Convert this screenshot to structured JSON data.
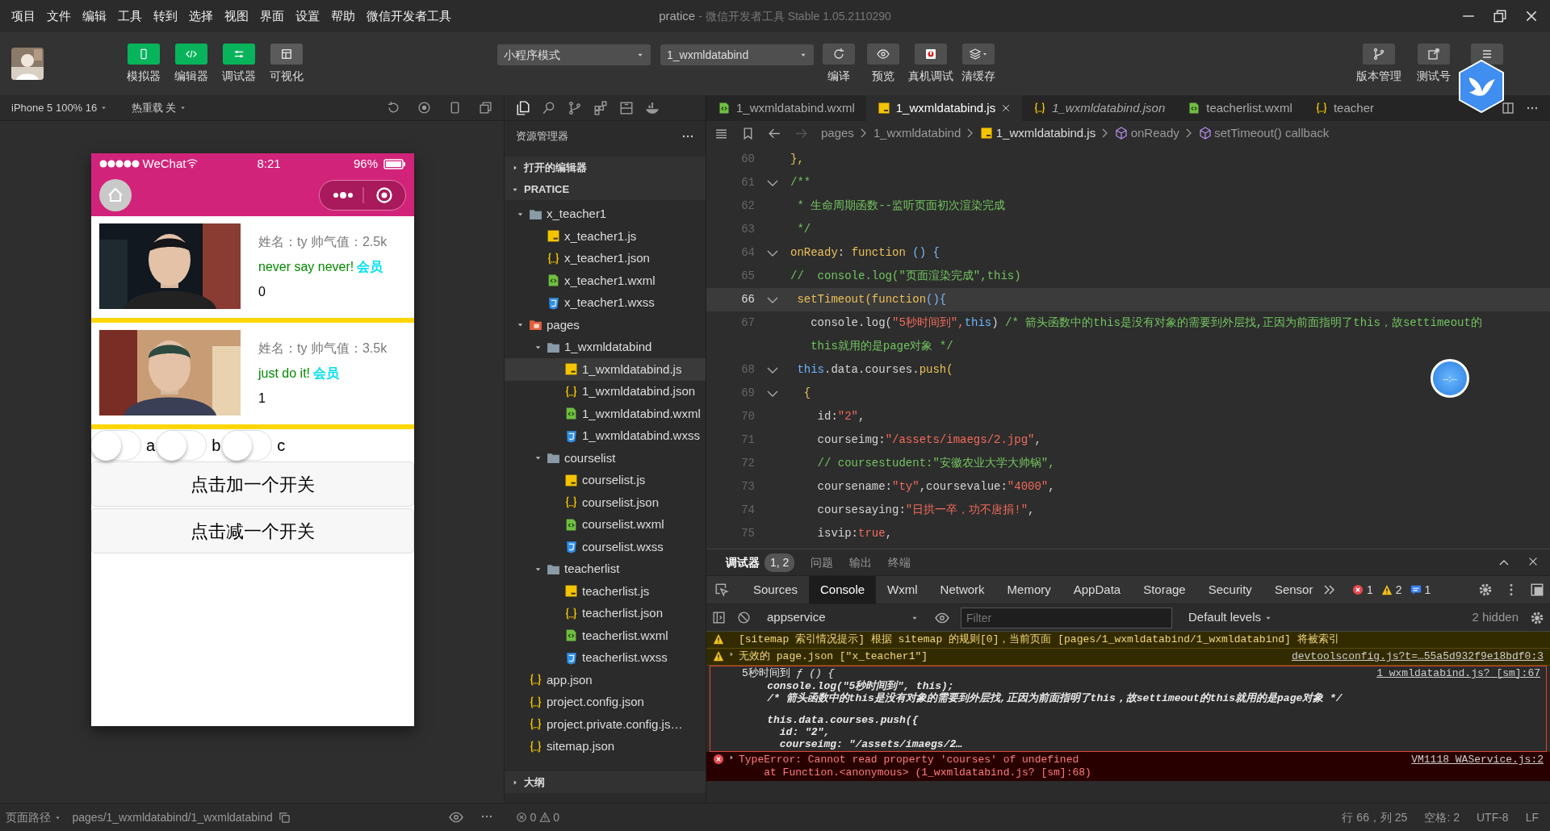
{
  "menu": [
    "项目",
    "文件",
    "编辑",
    "工具",
    "转到",
    "选择",
    "视图",
    "界面",
    "设置",
    "帮助",
    "微信开发者工具"
  ],
  "window": {
    "title": "pratice",
    "subtitle": "- 微信开发者工具 Stable 1.05.2110290"
  },
  "toolbar": {
    "view_buttons": [
      {
        "label": "模拟器",
        "on": true
      },
      {
        "label": "编辑器",
        "on": true
      },
      {
        "label": "调试器",
        "on": true
      },
      {
        "label": "可视化",
        "on": false
      }
    ],
    "mode_select": "小程序模式",
    "compile_select": "1_wxmldatabind",
    "actions": [
      "编译",
      "预览",
      "真机调试",
      "清缓存"
    ],
    "right_buttons": [
      "版本管理",
      "测试号"
    ]
  },
  "simulator": {
    "device": "iPhone 5 100% 16",
    "hot_reload": "热重载 关",
    "phone": {
      "carrier": "WeChat",
      "time": "8:21",
      "battery": "96%",
      "cards": [
        {
          "info": "姓名：ty 帅气值：2.5k",
          "motto": "never say never!",
          "badge": "会员",
          "count": "0"
        },
        {
          "info": "姓名：ty 帅气值：3.5k",
          "motto": "just do it!",
          "badge": "会员",
          "count": "1"
        }
      ],
      "switches": [
        {
          "label": "a",
          "on": false
        },
        {
          "label": "b",
          "on": false
        },
        {
          "label": "c",
          "on": false
        }
      ],
      "buttons": [
        "点击加一个开关",
        "点击减一个开关"
      ]
    }
  },
  "explorer": {
    "title": "资源管理器",
    "sections": [
      {
        "label": "打开的编辑器",
        "expanded": false
      },
      {
        "label": "PRATICE",
        "expanded": true
      }
    ],
    "tree": [
      {
        "label": "x_teacher1",
        "kind": "folder",
        "expanded": true,
        "selected": false,
        "children": [
          {
            "label": "x_teacher1.js",
            "kind": "js",
            "selected": false
          },
          {
            "label": "x_teacher1.json",
            "kind": "json",
            "selected": false
          },
          {
            "label": "x_teacher1.wxml",
            "kind": "wxml",
            "selected": false
          },
          {
            "label": "x_teacher1.wxss",
            "kind": "wxss",
            "selected": false
          }
        ]
      },
      {
        "label": "pages",
        "kind": "pages",
        "expanded": true,
        "selected": false,
        "children": [
          {
            "label": "1_wxmldatabind",
            "kind": "folder",
            "expanded": true,
            "selected": false,
            "children": [
              {
                "label": "1_wxmldatabind.js",
                "kind": "js",
                "selected": true
              },
              {
                "label": "1_wxmldatabind.json",
                "kind": "json",
                "selected": false
              },
              {
                "label": "1_wxmldatabind.wxml",
                "kind": "wxml",
                "selected": false
              },
              {
                "label": "1_wxmldatabind.wxss",
                "kind": "wxss",
                "selected": false
              }
            ]
          },
          {
            "label": "courselist",
            "kind": "folder",
            "expanded": true,
            "selected": false,
            "children": [
              {
                "label": "courselist.js",
                "kind": "js",
                "selected": false
              },
              {
                "label": "courselist.json",
                "kind": "json",
                "selected": false
              },
              {
                "label": "courselist.wxml",
                "kind": "wxml",
                "selected": false
              },
              {
                "label": "courselist.wxss",
                "kind": "wxss",
                "selected": false
              }
            ]
          },
          {
            "label": "teacherlist",
            "kind": "folder",
            "expanded": true,
            "selected": false,
            "children": [
              {
                "label": "teacherlist.js",
                "kind": "js",
                "selected": false
              },
              {
                "label": "teacherlist.json",
                "kind": "json",
                "selected": false
              },
              {
                "label": "teacherlist.wxml",
                "kind": "wxml",
                "selected": false
              },
              {
                "label": "teacherlist.wxss",
                "kind": "wxss",
                "selected": false
              }
            ]
          }
        ]
      },
      {
        "label": "app.json",
        "kind": "json",
        "selected": false
      },
      {
        "label": "project.config.json",
        "kind": "json",
        "selected": false
      },
      {
        "label": "project.private.config.js…",
        "kind": "json",
        "selected": false
      },
      {
        "label": "sitemap.json",
        "kind": "json",
        "selected": false
      }
    ],
    "outline": {
      "label": "大纲",
      "expanded": false
    }
  },
  "editor": {
    "tabs": [
      {
        "label": "1_wxmldatabind.wxml",
        "kind": "wxml",
        "selected": false,
        "preview": false
      },
      {
        "label": "1_wxmldatabind.js",
        "kind": "js",
        "selected": true,
        "preview": false
      },
      {
        "label": "1_wxmldatabind.json",
        "kind": "json",
        "selected": false,
        "preview": true
      },
      {
        "label": "teacherlist.wxml",
        "kind": "wxml",
        "selected": false,
        "preview": false
      },
      {
        "label": "teacher",
        "kind": "json",
        "selected": false,
        "preview": false
      }
    ],
    "breadcrumb": [
      {
        "label": "pages",
        "kind": "folder"
      },
      {
        "label": "1_wxmldatabind",
        "kind": "folder"
      },
      {
        "label": "1_wxmldatabind.js",
        "kind": "js"
      },
      {
        "label": "onReady",
        "kind": "symbol"
      },
      {
        "label": "setTimeout() callback",
        "kind": "symbol"
      }
    ],
    "lines": [
      {
        "no": "60",
        "kind": "plain",
        "current": false,
        "tokens": [
          {
            "t": "},",
            "kind": "kw"
          }
        ]
      },
      {
        "no": "61",
        "kind": "foldable",
        "current": false,
        "tokens": [
          {
            "t": "/**",
            "kind": "com"
          }
        ]
      },
      {
        "no": "62",
        "kind": "plain",
        "current": false,
        "tokens": [
          {
            "t": " * 生命周期函数--监听页面初次渲染完成",
            "kind": "com"
          }
        ]
      },
      {
        "no": "63",
        "kind": "plain",
        "current": false,
        "tokens": [
          {
            "t": " */",
            "kind": "com"
          }
        ]
      },
      {
        "no": "64",
        "kind": "foldable",
        "current": false,
        "tokens": [
          {
            "t": "onReady",
            "kind": "kw"
          },
          {
            "t": ": ",
            "kind": "pl"
          },
          {
            "t": "function",
            "kind": "kw"
          },
          {
            "t": " () {",
            "kind": "br"
          }
        ]
      },
      {
        "no": "65",
        "kind": "plain",
        "current": false,
        "tokens": [
          {
            "t": "//  console.log(\"页面渲染完成\",this)",
            "kind": "com"
          }
        ]
      },
      {
        "no": "66",
        "kind": "foldable",
        "current": true,
        "tokens": [
          {
            "t": " setTimeout",
            "kind": "kw"
          },
          {
            "t": "(",
            "kind": "kw"
          },
          {
            "t": "function",
            "kind": "kw"
          },
          {
            "t": "(){",
            "kind": "br"
          }
        ]
      },
      {
        "no": "67",
        "kind": "plain",
        "current": false,
        "tokens": [
          {
            "t": "   console.log(",
            "kind": "pl"
          },
          {
            "t": "\"5秒时间到\",",
            "kind": "str"
          },
          {
            "t": "this",
            "kind": "th"
          },
          {
            "t": ") ",
            "kind": "pl"
          },
          {
            "t": "/* 箭头函数中的this是没有对象的需要到外层找,正因为前面指明了this，故settimeout的",
            "kind": "com"
          }
        ]
      },
      {
        "kind": "wrap",
        "current": false,
        "tokens": [
          {
            "t": "   this就用的是page对象 */",
            "kind": "com"
          }
        ]
      },
      {
        "no": "68",
        "kind": "foldable",
        "current": false,
        "tokens": [
          {
            "t": " this",
            "kind": "th"
          },
          {
            "t": ".data.courses.",
            "kind": "pl"
          },
          {
            "t": "push(",
            "kind": "kw"
          }
        ]
      },
      {
        "no": "69",
        "kind": "foldable",
        "current": false,
        "tokens": [
          {
            "t": "  {",
            "kind": "kw"
          }
        ]
      },
      {
        "no": "70",
        "kind": "plain",
        "current": false,
        "tokens": [
          {
            "t": "    id:",
            "kind": "pl"
          },
          {
            "t": "\"2\"",
            "kind": "str"
          },
          {
            "t": ",",
            "kind": "pl"
          }
        ]
      },
      {
        "no": "71",
        "kind": "plain",
        "current": false,
        "tokens": [
          {
            "t": "    courseimg:",
            "kind": "pl"
          },
          {
            "t": "\"/assets/imaegs/2.jpg\"",
            "kind": "str"
          },
          {
            "t": ",",
            "kind": "pl"
          }
        ]
      },
      {
        "no": "72",
        "kind": "plain",
        "current": false,
        "tokens": [
          {
            "t": "    // coursestudent:\"安徽农业大学大帅锅\",",
            "kind": "com"
          }
        ]
      },
      {
        "no": "73",
        "kind": "plain",
        "current": false,
        "tokens": [
          {
            "t": "    coursename:",
            "kind": "pl"
          },
          {
            "t": "\"ty\"",
            "kind": "str"
          },
          {
            "t": ",coursevalue:",
            "kind": "pl"
          },
          {
            "t": "\"4000\"",
            "kind": "str"
          },
          {
            "t": ",",
            "kind": "pl"
          }
        ]
      },
      {
        "no": "74",
        "kind": "plain",
        "current": false,
        "tokens": [
          {
            "t": "    coursesaying:",
            "kind": "pl"
          },
          {
            "t": "\"日拱一卒，功不唐捐!\"",
            "kind": "str"
          },
          {
            "t": ",",
            "kind": "pl"
          }
        ]
      },
      {
        "no": "75",
        "kind": "plain",
        "current": false,
        "tokens": [
          {
            "t": "    isvip:",
            "kind": "pl"
          },
          {
            "t": "true",
            "kind": "str"
          },
          {
            "t": ",",
            "kind": "pl"
          }
        ]
      }
    ],
    "timer": "--:--"
  },
  "debugger": {
    "panel_tabs": [
      {
        "label": "调试器",
        "badge": "1, 2",
        "selected": true
      },
      {
        "label": "问题",
        "selected": false
      },
      {
        "label": "输出",
        "selected": false
      },
      {
        "label": "终端",
        "selected": false
      }
    ],
    "devtools_tabs": [
      {
        "label": "Sources",
        "selected": false
      },
      {
        "label": "Console",
        "selected": true
      },
      {
        "label": "Wxml",
        "selected": false
      },
      {
        "label": "Network",
        "selected": false
      },
      {
        "label": "Memory",
        "selected": false
      },
      {
        "label": "AppData",
        "selected": false
      },
      {
        "label": "Storage",
        "selected": false
      },
      {
        "label": "Security",
        "selected": false
      },
      {
        "label": "Sensor",
        "selected": false
      }
    ],
    "counts": {
      "errors": "1",
      "warnings": "2",
      "info": "1"
    },
    "context": "appservice",
    "filter": {
      "placeholder": "Filter"
    },
    "levels": "Default levels",
    "hidden": "2 hidden",
    "messages": [
      {
        "kind": "warn",
        "expandable": false,
        "highlighted": false,
        "lines": [
          "[sitemap 索引情况提示] 根据 sitemap 的规则[0]，当前页面 [pages/1_wxmldatabind/1_wxmldatabind] 将被索引"
        ]
      },
      {
        "kind": "warn",
        "expandable": true,
        "highlighted": false,
        "lines": [
          "无效的 page.json [\"x_teacher1\"]"
        ],
        "source": "devtoolsconfig.js?t=…55a5d932f9e18bdf0:3"
      },
      {
        "kind": "log",
        "expandable": false,
        "highlighted": true,
        "lines": [
          "5秒时间到 *ƒ () {*",
          "    console.log(\"5秒时间到\", this);",
          "    /* 箭头函数中的this是没有对象的需要到外层找,正因为前面指明了this，故settimeout的this就用的是page对象 */"
        ],
        "more_lines": [
          "    this.data.courses.push({",
          "      id: \"2\",",
          "      courseimg: \"/assets/imaegs/2…"
        ],
        "source": "1_wxmldatabind.js? [sm]:67"
      },
      {
        "kind": "error",
        "expandable": true,
        "highlighted": false,
        "lines": [
          "TypeError: Cannot read property 'courses' of undefined",
          "    at Function.<anonymous> (1_wxmldatabind.js? [sm]:68)"
        ],
        "source": "VM1118 WAService.js:2"
      }
    ]
  },
  "status_bar": {
    "path_label": "页面路径",
    "path": "pages/1_wxmldatabind/1_wxmldatabind",
    "errors": "0",
    "warnings": "0",
    "position": "行 66，列 25",
    "spaces": "空格: 2",
    "encoding": "UTF-8",
    "eol": "LF"
  }
}
